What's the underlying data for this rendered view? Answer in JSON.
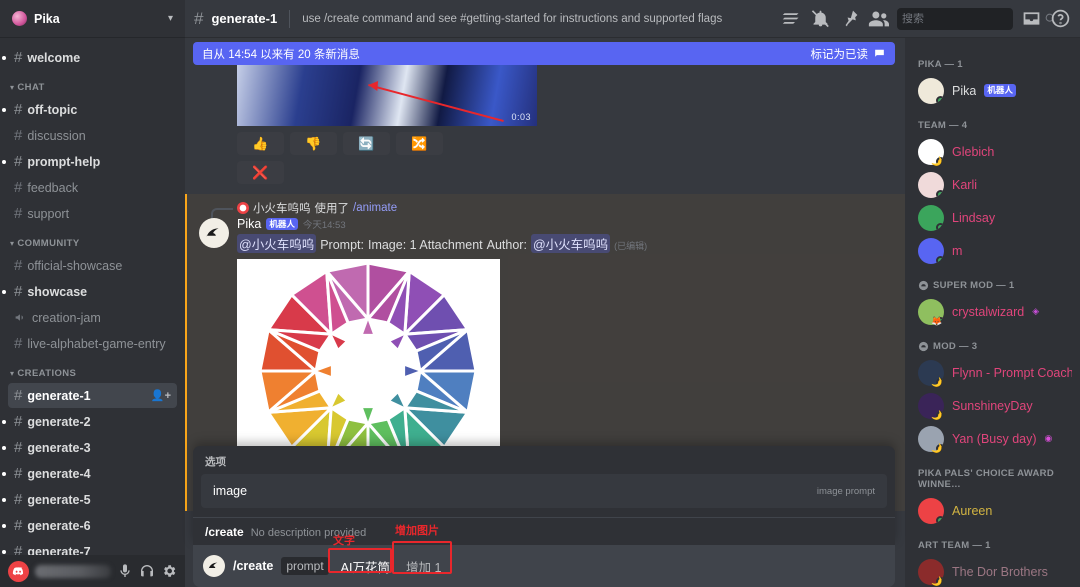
{
  "server": {
    "name": "Pika",
    "logo_icon": "pika-logo",
    "chevron_icon": "chevron-down-icon"
  },
  "sidebar": {
    "top_channels": [
      {
        "label": "welcome",
        "icon": "hash-icon",
        "unread": true,
        "type": "text"
      }
    ],
    "categories": [
      {
        "label": "CHAT",
        "channels": [
          {
            "label": "off-topic",
            "icon": "hash-icon",
            "unread": true,
            "type": "text"
          },
          {
            "label": "discussion",
            "icon": "hash-icon",
            "unread": false,
            "type": "text"
          },
          {
            "label": "prompt-help",
            "icon": "hash-icon",
            "unread": true,
            "type": "text"
          },
          {
            "label": "feedback",
            "icon": "hash-icon",
            "unread": false,
            "type": "text"
          },
          {
            "label": "support",
            "icon": "hash-icon",
            "unread": false,
            "type": "text"
          }
        ]
      },
      {
        "label": "COMMUNITY",
        "channels": [
          {
            "label": "official-showcase",
            "icon": "hash-icon",
            "unread": false,
            "type": "text"
          },
          {
            "label": "showcase",
            "icon": "hash-icon",
            "unread": true,
            "type": "text"
          },
          {
            "label": "creation-jam",
            "icon": "announcement-icon",
            "unread": false,
            "type": "announcement"
          },
          {
            "label": "live-alphabet-game-entry",
            "icon": "hash-icon",
            "unread": false,
            "type": "text"
          }
        ]
      },
      {
        "label": "CREATIONS",
        "channels": [
          {
            "label": "generate-1",
            "icon": "hash-icon",
            "unread": false,
            "active": true,
            "type": "text",
            "trailing_icon": "add-member-icon"
          },
          {
            "label": "generate-2",
            "icon": "hash-icon",
            "unread": true,
            "type": "text"
          },
          {
            "label": "generate-3",
            "icon": "hash-icon",
            "unread": true,
            "type": "text"
          },
          {
            "label": "generate-4",
            "icon": "hash-icon",
            "unread": true,
            "type": "text"
          },
          {
            "label": "generate-5",
            "icon": "hash-icon",
            "unread": true,
            "type": "text"
          },
          {
            "label": "generate-6",
            "icon": "hash-icon",
            "unread": true,
            "type": "text"
          },
          {
            "label": "generate-7",
            "icon": "hash-icon",
            "unread": true,
            "type": "text"
          }
        ]
      }
    ],
    "userbar": {
      "username": "",
      "avatar_icon": "discord-avatar",
      "controls": [
        {
          "icon": "microphone-icon",
          "name": "mute-button"
        },
        {
          "icon": "headphones-icon",
          "name": "deafen-button"
        },
        {
          "icon": "gear-icon",
          "name": "user-settings-button"
        }
      ]
    }
  },
  "topbar": {
    "hash_icon": "hash-icon",
    "channel": "generate-1",
    "topic": "use /create command and see #getting-started for instructions and supported flags",
    "icons": [
      {
        "icon": "threads-icon",
        "name": "threads-button"
      },
      {
        "icon": "bell-muted-icon",
        "name": "notification-settings-button"
      },
      {
        "icon": "pin-icon",
        "name": "pinned-messages-button"
      },
      {
        "icon": "members-icon",
        "name": "member-list-toggle"
      }
    ],
    "search": {
      "placeholder": "搜索",
      "value": "",
      "icon": "search-icon"
    },
    "inbox_icon": "inbox-icon",
    "help_icon": "help-icon"
  },
  "banner": {
    "text": "自从 14:54 以来有 20 条新消息",
    "action": "标记为已读",
    "icon": "mark-read-icon",
    "color": "#5865f2"
  },
  "message": {
    "reply_user": "小火车呜呜",
    "reply_verb": "使用了",
    "reply_command": "/animate",
    "author": "Pika",
    "bot_tag": "机器人",
    "timestamp": "今天14:53",
    "mention": "@小火车呜呜",
    "body_prompt_label": "Prompt:",
    "body_image_label": "Image: 1 Attachment",
    "body_author_label": "Author:",
    "body_author_mention": "@小火车呜呜",
    "edited": "(已编辑)",
    "video": {
      "time": "0:03 / 0:03",
      "progress_percent": 100,
      "mute_icon": "volume-icon",
      "fullscreen_icon": "fullscreen-icon",
      "replay_icon": "replay-icon"
    },
    "reactions": [
      {
        "emoji": "👍",
        "name": "reaction-thumbs-up"
      },
      {
        "emoji": "👎",
        "name": "reaction-thumbs-down"
      },
      {
        "emoji": "🔄",
        "name": "reaction-retry"
      },
      {
        "emoji": "🔀",
        "name": "reaction-shuffle"
      },
      {
        "emoji": "❌",
        "name": "reaction-delete"
      }
    ]
  },
  "popup": {
    "header": "选项",
    "option": "image",
    "option_hint": "image prompt",
    "command_name": "/create",
    "command_desc": "No description provided"
  },
  "input": {
    "avatar_icon": "pika-bot-avatar",
    "command": "/create",
    "arg_label": "prompt",
    "text_value": "AI万花筒",
    "image_value": "增加 1"
  },
  "annotations": [
    {
      "label": "文字",
      "target": "text-value-box"
    },
    {
      "label": "增加图片",
      "target": "image-value-box"
    }
  ],
  "members": {
    "groups": [
      {
        "label": "PIKA — 1",
        "crest": null,
        "users": [
          {
            "name": "Pika",
            "color": "#dcddde",
            "status": "online",
            "bot_tag": "机器人",
            "avatar": "#efe9da"
          }
        ]
      },
      {
        "label": "TEAM — 4",
        "crest": null,
        "users": [
          {
            "name": "Glebich",
            "color": "#e0457b",
            "status": "idle",
            "avatar": "#ffffff",
            "mini_emoji": "🌙"
          },
          {
            "name": "Karli",
            "color": "#e0457b",
            "status": "online",
            "avatar": "#f0dada"
          },
          {
            "name": "Lindsay",
            "color": "#e0457b",
            "status": "online",
            "avatar": "#3ba55c"
          },
          {
            "name": "m",
            "color": "#e0457b",
            "status": "online",
            "avatar": "#5865f2"
          }
        ]
      },
      {
        "label": "SUPER MOD — 1",
        "crest": "crest-icon",
        "users": [
          {
            "name": "crystalwizard",
            "color": "#e0457b",
            "status": "online",
            "avatar": "#8fbf5f",
            "gem": "◈",
            "mini_emoji": "🦊"
          }
        ]
      },
      {
        "label": "MOD — 3",
        "crest": "crest-icon",
        "users": [
          {
            "name": "Flynn - Prompt Coach",
            "color": "#e0457b",
            "status": "idle",
            "avatar": "#2c3a52",
            "mini_emoji": "🌙"
          },
          {
            "name": "SunshineyDay",
            "color": "#e0457b",
            "status": "idle",
            "avatar": "#3a2458",
            "mini_emoji": "🌙"
          },
          {
            "name": "Yan  (Busy day)",
            "color": "#e0457b",
            "status": "idle",
            "avatar": "#9aa3b0",
            "gem": "◉",
            "mini_emoji": "🌙"
          }
        ]
      },
      {
        "label": "PIKA PALS' CHOICE AWARD WINNE…",
        "crest": null,
        "users": [
          {
            "name": "Aureen",
            "color": "#d2b442",
            "status": "online",
            "avatar": "#ed4245"
          }
        ]
      },
      {
        "label": "ART TEAM — 1",
        "crest": null,
        "users": [
          {
            "name": "The Dor Brothers",
            "color": "#9b7683",
            "status": "idle",
            "avatar": "#8b2b2b",
            "mini_emoji": "🌙"
          }
        ]
      }
    ]
  }
}
